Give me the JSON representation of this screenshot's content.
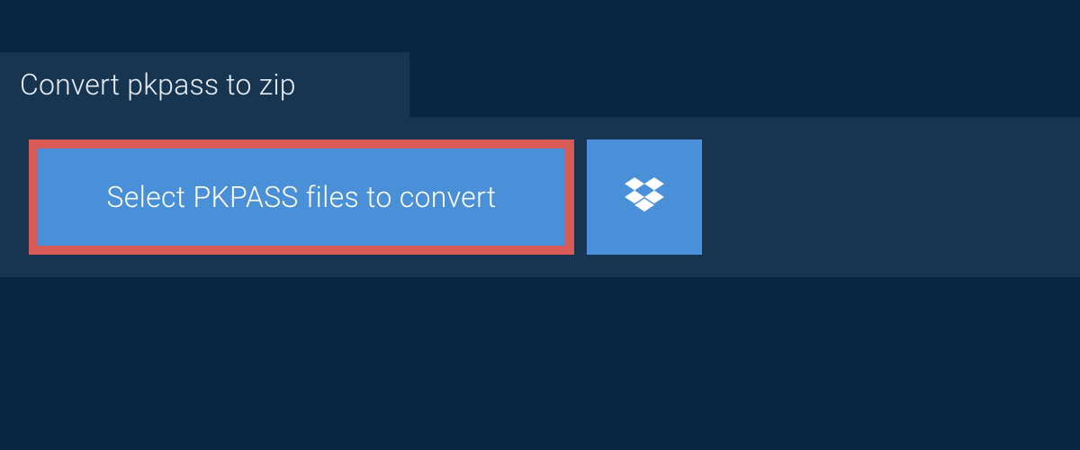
{
  "header": {
    "tab_label": "Convert pkpass to zip"
  },
  "actions": {
    "select_files_label": "Select PKPASS files to convert"
  },
  "colors": {
    "page_bg": "#0a2540",
    "panel_bg": "#173450",
    "button_bg": "#4a90d9",
    "button_border_active": "#d95b57",
    "text_light": "#e8eef5"
  }
}
